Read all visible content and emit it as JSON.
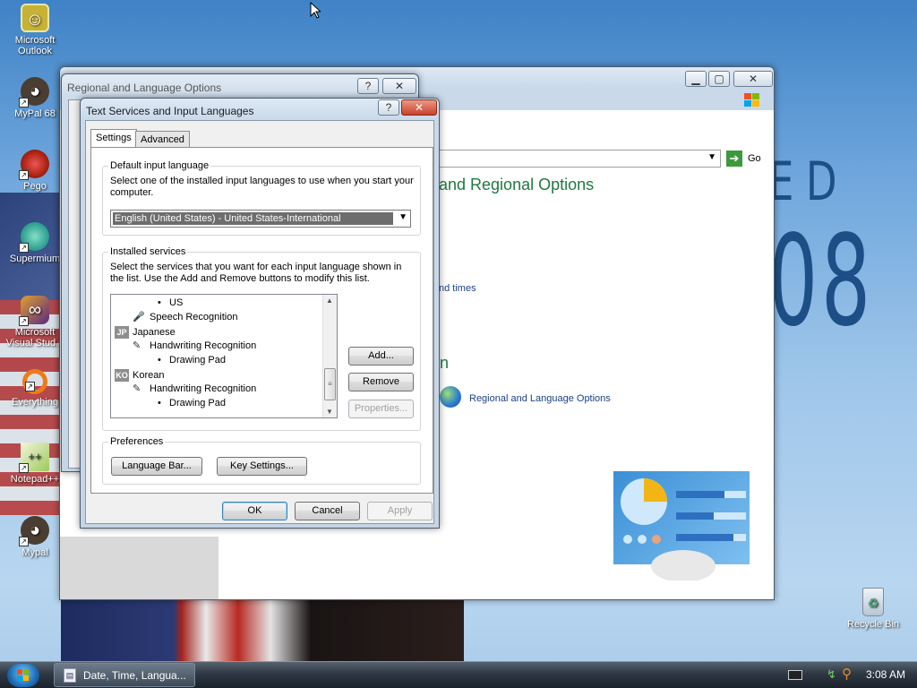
{
  "desktop": {
    "icons": [
      {
        "label": "Microsoft Outlook",
        "icon": "outlook-icon"
      },
      {
        "label": "MyPal 68",
        "icon": "raccoon-icon"
      },
      {
        "label": "Pego",
        "icon": "pego-icon"
      },
      {
        "label": "Supermium",
        "icon": "supermium-icon"
      },
      {
        "label": "Microsoft Visual Stud...",
        "icon": "visual-studio-icon"
      },
      {
        "label": "Everything",
        "icon": "search-ring-icon"
      },
      {
        "label": "Notepad++",
        "icon": "notepad-icon"
      },
      {
        "label": "Mypal",
        "icon": "raccoon-icon"
      },
      {
        "label": "Recycle Bin",
        "icon": "recycle-bin-icon"
      }
    ],
    "wallpaper_text_1": "ED",
    "wallpaper_text_2": "08"
  },
  "control_panel": {
    "go_label": "Go",
    "heading": "and Regional Options",
    "link_times": "nd times",
    "subheading": "n",
    "link_regional": "Regional and Language Options"
  },
  "regional_dialog": {
    "title": "Regional and Language Options",
    "help_btn": "?",
    "close_btn": "✕"
  },
  "text_services": {
    "title": "Text Services and Input Languages",
    "help_btn": "?",
    "close_btn": "✕",
    "tabs": [
      "Settings",
      "Advanced"
    ],
    "default_group": {
      "label": "Default input language",
      "description": "Select one of the installed input languages to use when you start your computer.",
      "selected": "English (United States) - United States-International"
    },
    "services_group": {
      "label": "Installed services",
      "description": "Select the services that you want for each input language shown in the list. Use the Add and Remove buttons to modify this list.",
      "items": [
        {
          "text": "US",
          "kind": "bullet"
        },
        {
          "text": "Speech Recognition",
          "kind": "service"
        },
        {
          "text": "Japanese",
          "kind": "language",
          "badge": "JP"
        },
        {
          "text": "Handwriting Recognition",
          "kind": "service"
        },
        {
          "text": "Drawing Pad",
          "kind": "bullet"
        },
        {
          "text": "Korean",
          "kind": "language",
          "badge": "KO"
        },
        {
          "text": "Handwriting Recognition",
          "kind": "service"
        },
        {
          "text": "Drawing Pad",
          "kind": "bullet"
        }
      ],
      "add": "Add...",
      "remove": "Remove",
      "properties": "Properties..."
    },
    "preferences": {
      "label": "Preferences",
      "language_bar": "Language Bar...",
      "key_settings": "Key Settings..."
    },
    "ok": "OK",
    "cancel": "Cancel",
    "apply": "Apply"
  },
  "taskbar": {
    "task_label": "Date, Time, Langua...",
    "clock": "3:08 AM"
  }
}
